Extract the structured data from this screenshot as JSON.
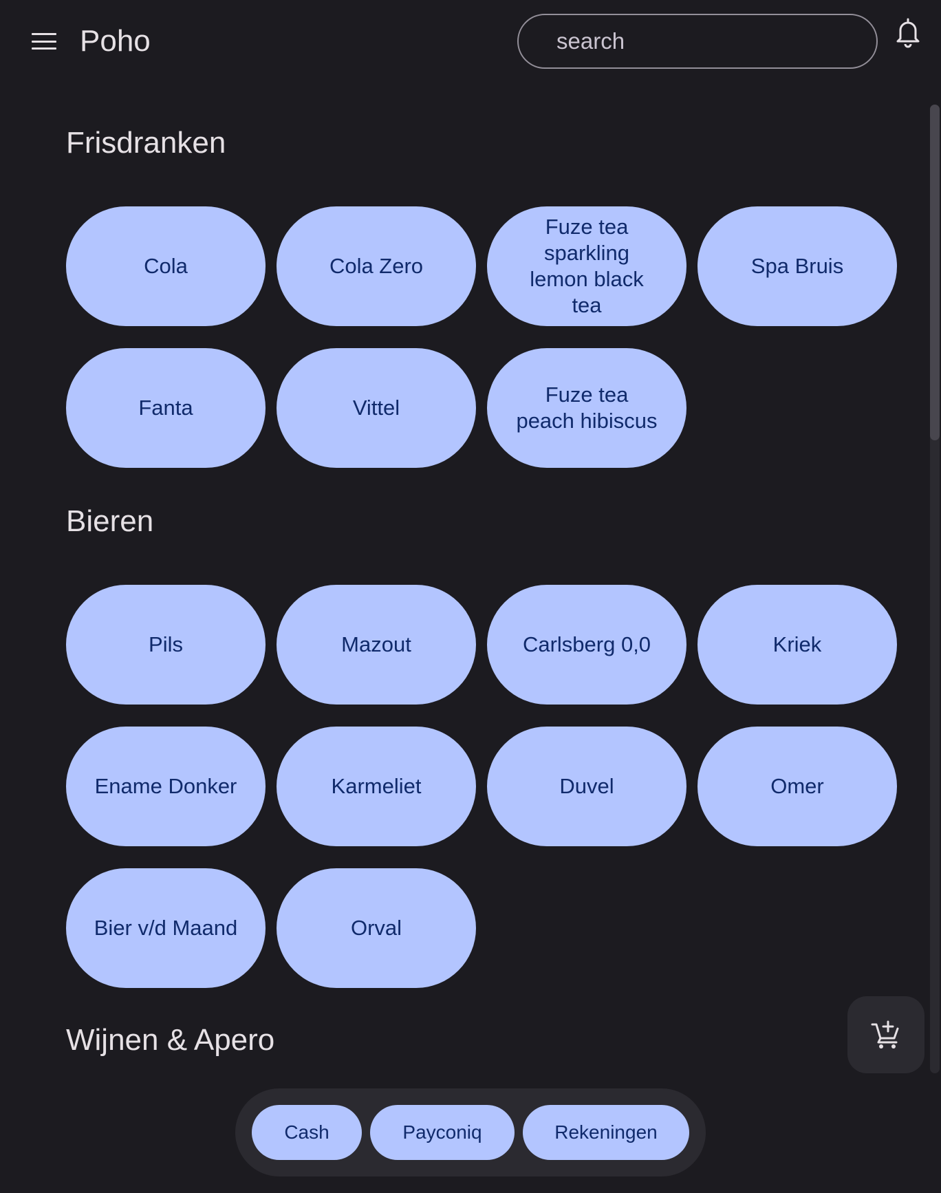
{
  "app": {
    "title": "Poho"
  },
  "search": {
    "placeholder": "search"
  },
  "icons": {
    "menu": "menu-icon",
    "bell": "bell-icon",
    "cart": "add-shopping-cart-icon"
  },
  "colors": {
    "background": "#1c1b20",
    "chip": "#b3c5ff",
    "chip_text": "#102a6b",
    "surface": "#2b2a30"
  },
  "sections": [
    {
      "title": "Frisdranken",
      "items": [
        "Cola",
        "Cola Zero",
        "Fuze tea sparkling lemon black tea",
        "Spa Bruis",
        "Fanta",
        "Vittel",
        "Fuze tea peach hibiscus"
      ]
    },
    {
      "title": "Bieren",
      "items": [
        "Pils",
        "Mazout",
        "Carlsberg 0,0",
        "Kriek",
        "Ename Donker",
        "Karmeliet",
        "Duvel",
        "Omer",
        "Bier v/d Maand",
        "Orval"
      ]
    },
    {
      "title": "Wijnen & Apero",
      "items": []
    }
  ],
  "payment": {
    "cash": "Cash",
    "payconiq": "Payconiq",
    "accounts": "Rekeningen"
  }
}
